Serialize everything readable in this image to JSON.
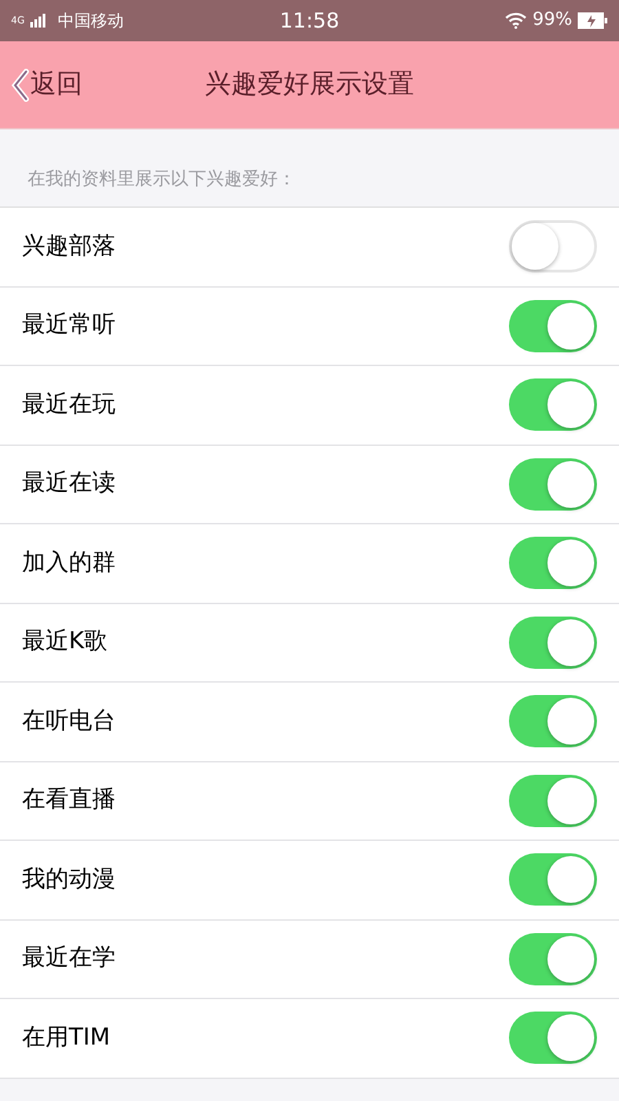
{
  "status_bar": {
    "network": "4G",
    "carrier": "中国移动",
    "time": "11:58",
    "battery": "99%"
  },
  "nav": {
    "back": "返回",
    "title": "兴趣爱好展示设置"
  },
  "section_header": "在我的资料里展示以下兴趣爱好：",
  "settings": [
    {
      "label": "兴趣部落",
      "on": false
    },
    {
      "label": "最近常听",
      "on": true
    },
    {
      "label": "最近在玩",
      "on": true
    },
    {
      "label": "最近在读",
      "on": true
    },
    {
      "label": "加入的群",
      "on": true
    },
    {
      "label": "最近K歌",
      "on": true
    },
    {
      "label": "在听电台",
      "on": true
    },
    {
      "label": "在看直播",
      "on": true
    },
    {
      "label": "我的动漫",
      "on": true
    },
    {
      "label": "最近在学",
      "on": true
    },
    {
      "label": "在用TIM",
      "on": true
    }
  ]
}
